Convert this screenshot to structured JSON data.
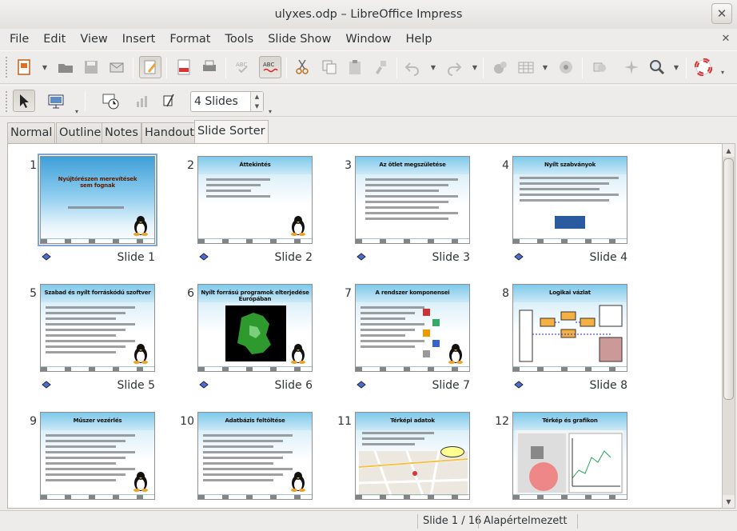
{
  "window": {
    "title": "ulyxes.odp – LibreOffice Impress"
  },
  "menu": [
    {
      "label": "File",
      "key": "F"
    },
    {
      "label": "Edit",
      "key": "E"
    },
    {
      "label": "View",
      "key": "V"
    },
    {
      "label": "Insert",
      "key": "I"
    },
    {
      "label": "Format",
      "key": "o"
    },
    {
      "label": "Tools",
      "key": "T"
    },
    {
      "label": "Slide Show",
      "key": "d"
    },
    {
      "label": "Window",
      "key": "W"
    },
    {
      "label": "Help",
      "key": "H"
    }
  ],
  "toolbar2": {
    "slides_per_row": "4 Slides"
  },
  "tabs": [
    "Normal",
    "Outline",
    "Notes",
    "Handout",
    "Slide Sorter"
  ],
  "active_tab": "Slide Sorter",
  "slides": [
    {
      "num": "1",
      "label": "Slide 1",
      "title": "Nyújtórészen merevítések sem fognak",
      "kind": "title"
    },
    {
      "num": "2",
      "label": "Slide 2",
      "title": "Áttekintés",
      "kind": "bullets"
    },
    {
      "num": "3",
      "label": "Slide 3",
      "title": "Az ötlet megszületése",
      "kind": "timeline"
    },
    {
      "num": "4",
      "label": "Slide 4",
      "title": "Nyílt szabványok",
      "kind": "ogc"
    },
    {
      "num": "5",
      "label": "Slide 5",
      "title": "Szabad és nyílt forráskódú szoftver",
      "kind": "text"
    },
    {
      "num": "6",
      "label": "Slide 6",
      "title": "Nyílt forrású programok elterjedése Európában",
      "kind": "map"
    },
    {
      "num": "7",
      "label": "Slide 7",
      "title": "A rendszer komponensei",
      "kind": "components"
    },
    {
      "num": "8",
      "label": "Slide 8",
      "title": "Logikai vázlat",
      "kind": "diagram"
    },
    {
      "num": "9",
      "label": "Slide 9",
      "title": "Műszer vezérlés",
      "kind": "text"
    },
    {
      "num": "10",
      "label": "Slide 10",
      "title": "Adatbázis feltöltése",
      "kind": "text2"
    },
    {
      "num": "11",
      "label": "Slide 11",
      "title": "Térképi adatok",
      "kind": "streetmap"
    },
    {
      "num": "12",
      "label": "Slide 12",
      "title": "Térkép és grafikon",
      "kind": "graph"
    }
  ],
  "status": {
    "slide_position": "Slide 1 / 16",
    "layout": "Alapértelmezett"
  },
  "colors": {
    "selection": "#7fa6d6",
    "slide_header": "#7ec8ea"
  }
}
